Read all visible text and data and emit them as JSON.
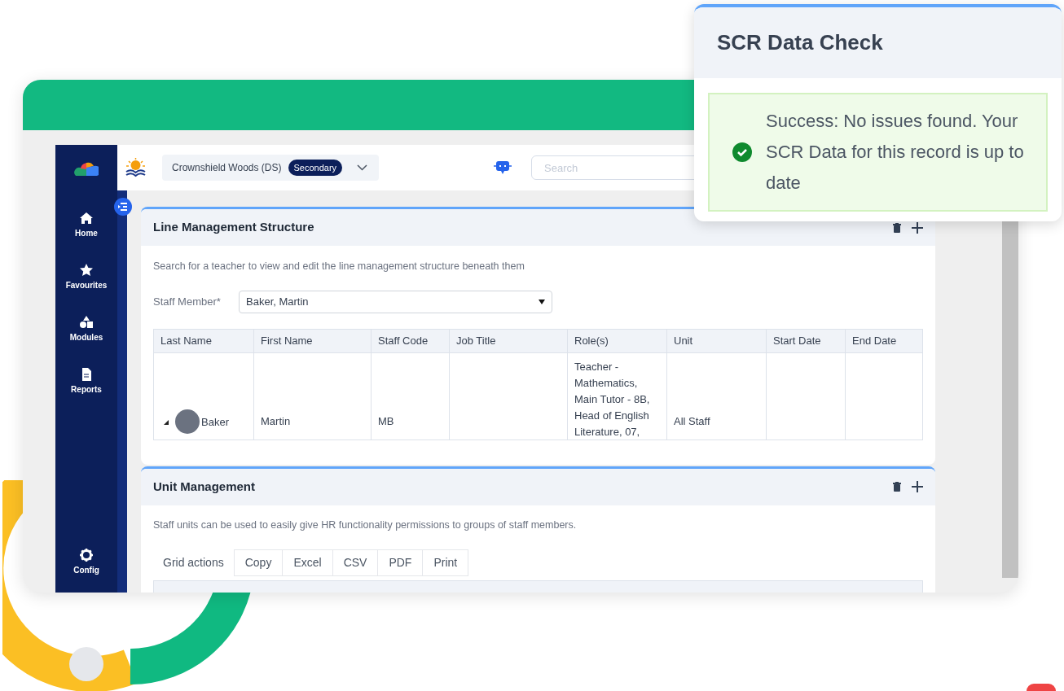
{
  "sidebar": {
    "items": [
      {
        "kind": "home",
        "label": "Home"
      },
      {
        "kind": "star",
        "label": "Favourites"
      },
      {
        "kind": "modules",
        "label": "Modules"
      },
      {
        "kind": "reports",
        "label": "Reports"
      },
      {
        "kind": "config",
        "label": "Config"
      }
    ]
  },
  "header": {
    "school": "Crownshield Woods (DS)",
    "badge": "Secondary",
    "search": {
      "placeholder": "Search"
    }
  },
  "line_management": {
    "title": "Line Management Structure",
    "description": "Search for a teacher to view and edit the line management structure beneath them",
    "field": {
      "label": "Staff Member*",
      "value": "Baker, Martin"
    },
    "table": {
      "columns": [
        "Last Name",
        "First Name",
        "Staff Code",
        "Job Title",
        "Role(s)",
        "Unit",
        "Start Date",
        "End Date"
      ],
      "rows": [
        {
          "expanded": true,
          "cells": [
            "Baker",
            "Martin",
            "MB",
            "",
            "Teacher - Mathematics, Main Tutor - 8B, Head of English Literature, 07,",
            "All Staff",
            "",
            ""
          ]
        }
      ]
    }
  },
  "unit_management": {
    "title": "Unit Management",
    "description": "Staff units can be used to easily give HR functionality permissions to groups of staff members.",
    "grid_actions_label": "Grid actions",
    "grid_actions": [
      "Copy",
      "Excel",
      "CSV",
      "PDF",
      "Print"
    ]
  },
  "popup": {
    "title": "SCR Data Check",
    "kind": "success",
    "message": "Success: No issues found. Your SCR Data for this record is up to date"
  }
}
